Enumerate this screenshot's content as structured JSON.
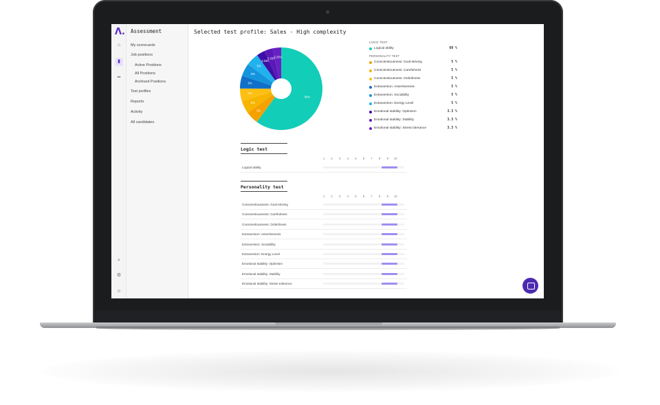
{
  "sidebar": {
    "logo": "Λ.",
    "section_title": "Assessment",
    "items": [
      {
        "label": "My scorecards"
      },
      {
        "label": "Job positions"
      },
      {
        "label": "Active Positions"
      },
      {
        "label": "All Positions"
      },
      {
        "label": "Archived Positions"
      },
      {
        "label": "Test profiles"
      },
      {
        "label": "Reports"
      },
      {
        "label": "Activity"
      },
      {
        "label": "All candidates"
      }
    ],
    "rail_icons": [
      "home-icon",
      "chart-icon",
      "people-icon",
      "search-icon",
      "gear-icon",
      "profile-icon"
    ]
  },
  "page": {
    "title": "Selected test profile: Sales - High complexity"
  },
  "chart_data": {
    "type": "pie",
    "slices": [
      {
        "label": "Logical ability",
        "value": 60,
        "text": "60%",
        "color": "#12cdb8"
      },
      {
        "label": "Conscientiousness: Goal-striving",
        "value": 5,
        "text": "5%",
        "color": "#f5a100"
      },
      {
        "label": "Conscientiousness: Carefulness",
        "value": 5,
        "text": "5%",
        "color": "#f7b500"
      },
      {
        "label": "Conscientiousness: Orderliness",
        "value": 5,
        "text": "5%",
        "color": "#fdbf12"
      },
      {
        "label": "Extraversion: Assertiveness",
        "value": 5,
        "text": "5%",
        "color": "#0f6fc9"
      },
      {
        "label": "Extraversion: Sociability",
        "value": 5,
        "text": "5%",
        "color": "#1494dd"
      },
      {
        "label": "Extraversion: Energy Level",
        "value": 5,
        "text": "5%",
        "color": "#21b2ee"
      },
      {
        "label": "Emotional stability: Optimism",
        "value": 3.3,
        "text": "3.33%",
        "color": "#3f0ea6"
      },
      {
        "label": "Emotional stability: Stability",
        "value": 3.3,
        "text": "3.33%",
        "color": "#5b18b8"
      },
      {
        "label": "Emotional stability: Stress tolerance",
        "value": 3.3,
        "text": "3.33%",
        "color": "#6a1fc4"
      }
    ]
  },
  "legend": {
    "logic_heading": "LOGIC TEST",
    "personality_heading": "PERSONALITY TEST",
    "logic": [
      {
        "name": "Logical ability",
        "value": "60 %",
        "color": "#12cdb8"
      }
    ],
    "personality": [
      {
        "name": "Conscientiousness: Goal-striving",
        "value": "5 %",
        "color": "#f5a100"
      },
      {
        "name": "Conscientiousness: Carefulness",
        "value": "5 %",
        "color": "#f7b500"
      },
      {
        "name": "Conscientiousness: Orderliness",
        "value": "5 %",
        "color": "#fdbf12"
      },
      {
        "name": "Extraversion: Assertiveness",
        "value": "5 %",
        "color": "#0f6fc9"
      },
      {
        "name": "Extraversion: Sociability",
        "value": "5 %",
        "color": "#1494dd"
      },
      {
        "name": "Extraversion: Energy Level",
        "value": "5 %",
        "color": "#21b2ee"
      },
      {
        "name": "Emotional stability: Optimism",
        "value": "3.3 %",
        "color": "#3f0ea6"
      },
      {
        "name": "Emotional stability: Stability",
        "value": "3.3 %",
        "color": "#5b18b8"
      },
      {
        "name": "Emotional stability: Stress tolerance",
        "value": "3.3 %",
        "color": "#6a1fc4"
      }
    ]
  },
  "logic_section": {
    "title": "Logic test",
    "scale": [
      "1",
      "2",
      "3",
      "4",
      "5",
      "6",
      "7",
      "8",
      "9",
      "10"
    ],
    "rows": [
      {
        "label": "Logical ability",
        "range": [
          8,
          10
        ]
      }
    ]
  },
  "personality_section": {
    "title": "Personality test",
    "scale": [
      "1",
      "2",
      "3",
      "4",
      "5",
      "6",
      "7",
      "8",
      "9",
      "10"
    ],
    "rows": [
      {
        "label": "Conscientiousness: Goal-striving",
        "range": [
          8,
          10
        ]
      },
      {
        "label": "Conscientiousness: Carefulness",
        "range": [
          8,
          10
        ]
      },
      {
        "label": "Conscientiousness: Orderliness",
        "range": [
          8,
          10
        ]
      },
      {
        "label": "Extraversion: Assertiveness",
        "range": [
          8,
          10
        ]
      },
      {
        "label": "Extraversion: Sociability",
        "range": [
          8,
          10
        ]
      },
      {
        "label": "Extraversion: Energy Level",
        "range": [
          8,
          10
        ]
      },
      {
        "label": "Emotional stability: Optimism",
        "range": [
          8,
          10
        ]
      },
      {
        "label": "Emotional stability: Stability",
        "range": [
          8,
          10
        ]
      },
      {
        "label": "Emotional stability: Stress tolerance",
        "range": [
          8,
          10
        ]
      }
    ]
  },
  "colors": {
    "accent": "#5b2bc9",
    "bar": "#9d8ef0",
    "chat": "#4b2bb0"
  }
}
